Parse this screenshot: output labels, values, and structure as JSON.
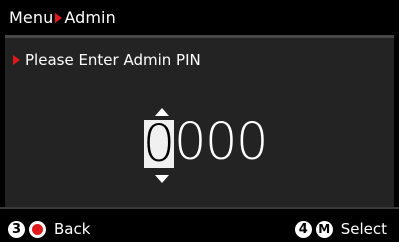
{
  "header": {
    "crumb_root": "Menu",
    "crumb_current": "Admin"
  },
  "prompt": {
    "text": "Please Enter Admin PIN"
  },
  "pin": {
    "digits": [
      "0",
      "0",
      "0",
      "0"
    ],
    "active_index": 0
  },
  "footer": {
    "back_key": "3",
    "back_label": "Back",
    "select_key": "4",
    "select_button": "M",
    "select_label": "Select"
  },
  "colors": {
    "accent_red": "#e01a1a",
    "panel_bg": "#232323",
    "screen_bg": "#000000"
  }
}
